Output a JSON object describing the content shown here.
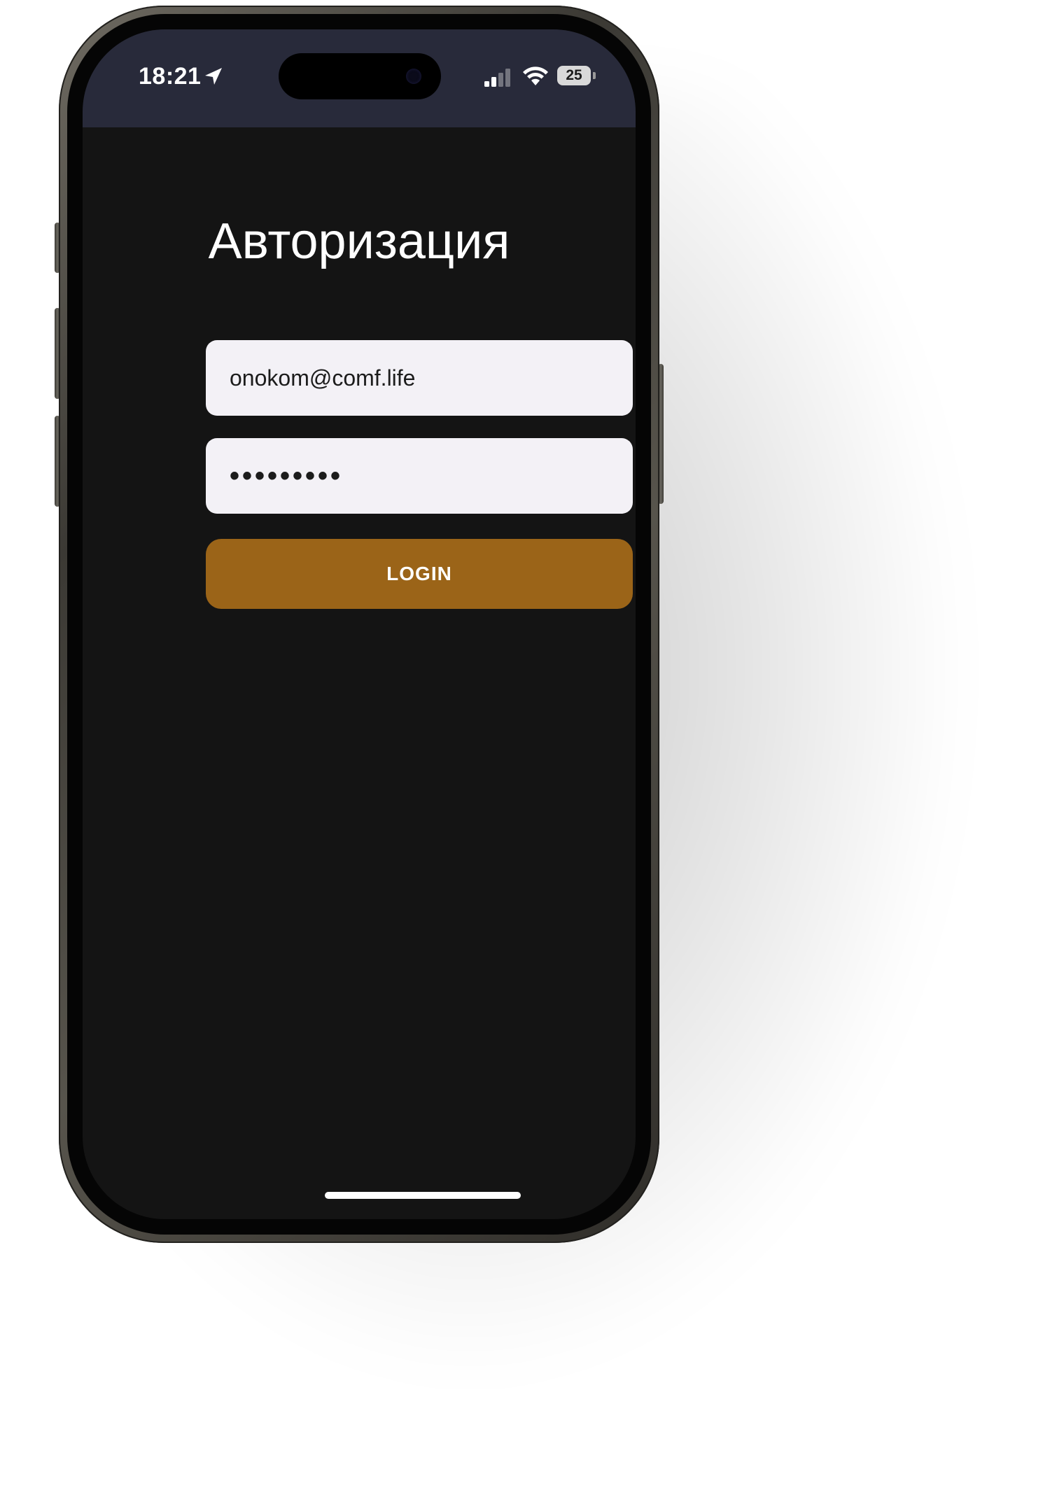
{
  "status_bar": {
    "time": "18:21",
    "battery_level": "25",
    "icons": [
      "location-arrow-icon",
      "cellular-signal-icon",
      "wifi-icon",
      "battery-icon"
    ]
  },
  "page": {
    "title": "Авторизация"
  },
  "login_form": {
    "email_value": "onokom@comf.life",
    "password_value": "•••••••••",
    "submit_label": "LOGIN"
  },
  "colors": {
    "status_bar_bg": "#282a3a",
    "screen_bg": "#141414",
    "input_bg": "#f3f1f6",
    "accent_button": "#9b6418"
  }
}
